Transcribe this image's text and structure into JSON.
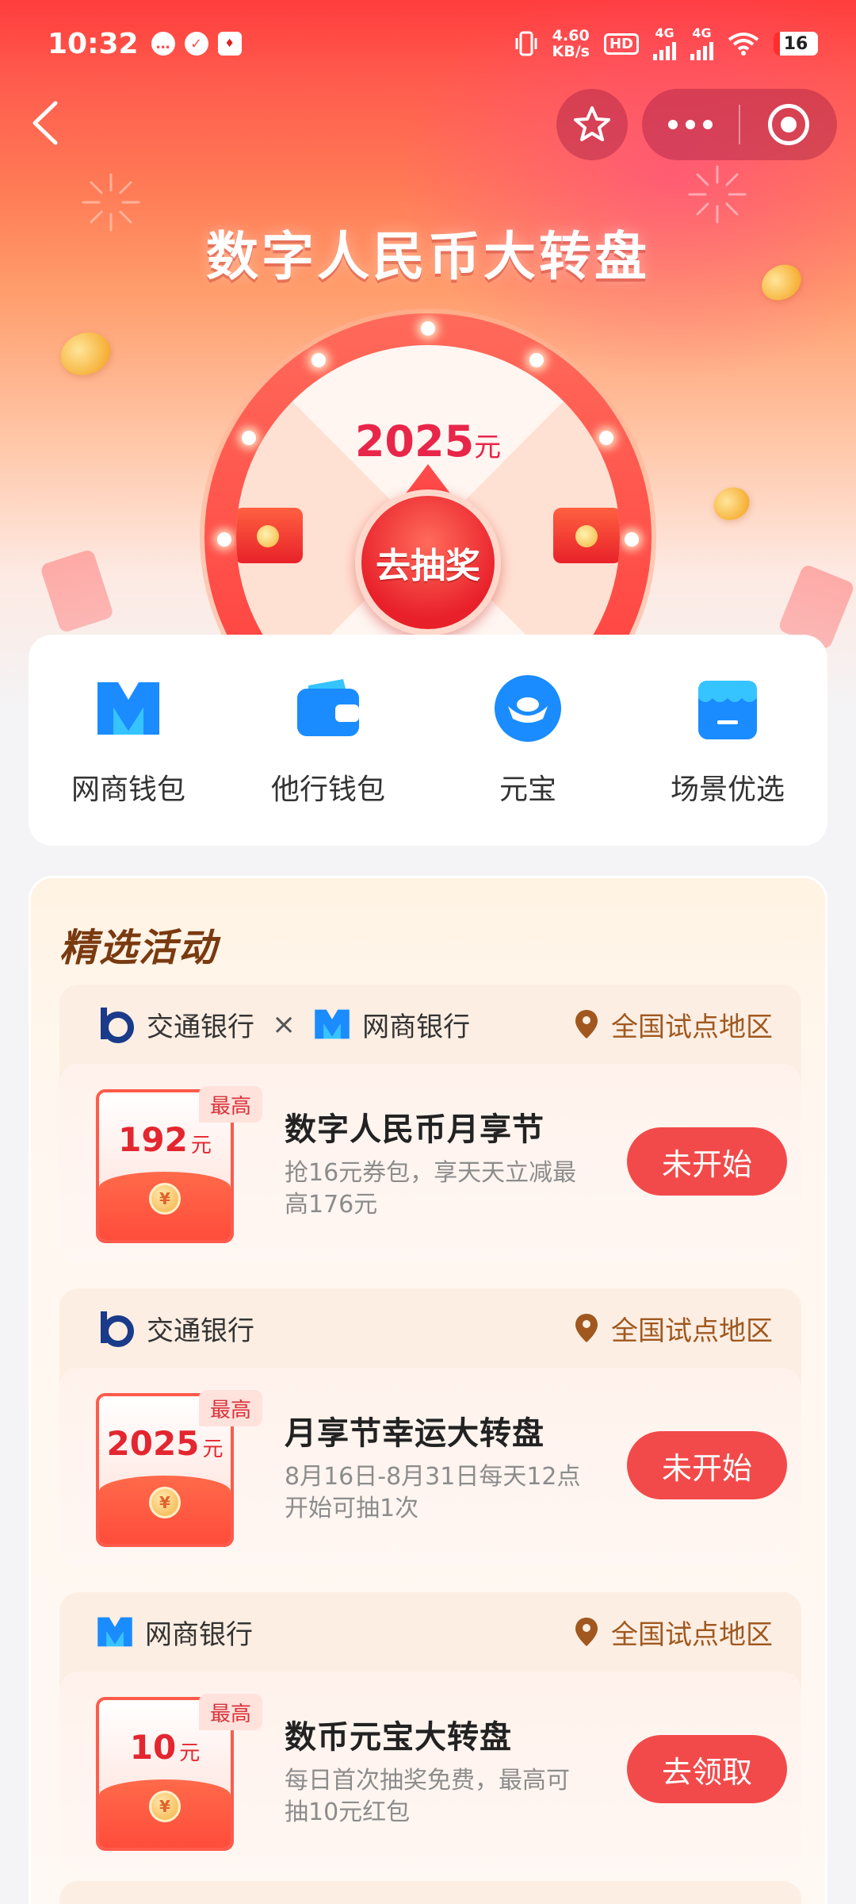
{
  "status_bar": {
    "time": "10:32",
    "net_speed_value": "4.60",
    "net_speed_unit": "KB/s",
    "hd_label": "HD",
    "signal_1": "4G",
    "signal_2": "4G",
    "battery": "16"
  },
  "hero": {
    "title": "数字人民币大转盘",
    "prize_amount": "2025",
    "prize_unit": "元",
    "spin_button": "去抽奖"
  },
  "quick_entries": [
    {
      "label": "网商钱包",
      "icon": "mybank-logo-icon"
    },
    {
      "label": "他行钱包",
      "icon": "wallet-icon"
    },
    {
      "label": "元宝",
      "icon": "ingot-icon"
    },
    {
      "label": "场景优选",
      "icon": "store-icon"
    }
  ],
  "activities": {
    "title": "精选活动",
    "items": [
      {
        "bank_1": "交通银行",
        "cross": "×",
        "bank_2": "网商银行",
        "location": "全国试点地区",
        "max_tag": "最高",
        "amount": "192",
        "unit": "元",
        "title": "数字人民币月享节",
        "desc": "抢16元券包，享天天立减最高176元",
        "button": "未开始"
      },
      {
        "bank_1": "交通银行",
        "location": "全国试点地区",
        "max_tag": "最高",
        "amount": "2025",
        "unit": "元",
        "title": "月享节幸运大转盘",
        "desc": "8月16日-8月31日每天12点开始可抽1次",
        "button": "未开始"
      },
      {
        "bank_1": "网商银行",
        "location": "全国试点地区",
        "max_tag": "最高",
        "amount": "10",
        "unit": "元",
        "title": "数币元宝大转盘",
        "desc": "每日首次抽奖免费，最高可抽10元红包",
        "button": "去领取"
      }
    ]
  },
  "colors": {
    "accent_red": "#f24a4a",
    "title_brown": "#7a3a10",
    "location_brown": "#a0581f",
    "brand_blue": "#1a8cff"
  }
}
